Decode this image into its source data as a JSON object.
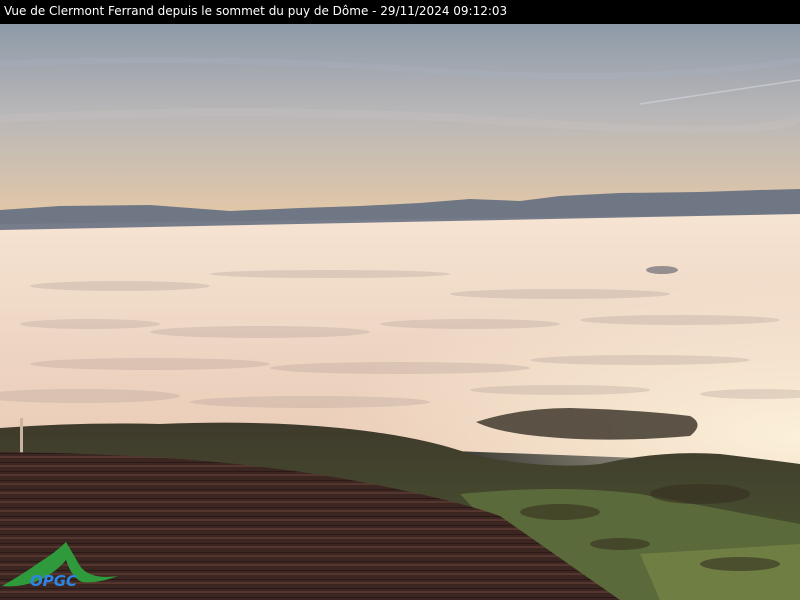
{
  "caption": {
    "text": "Vue de Clermont Ferrand depuis le sommet du puy de Dôme - 29/11/2024 09:12:03"
  },
  "logo": {
    "text": "OPGC",
    "color": "#2d86e6",
    "swoosh_color": "#2f9a3c"
  },
  "scene": {
    "sky_top": "#8b97a6",
    "sky_horizon": "#e8c8a0",
    "mountains": "#6f7684",
    "cloud_sea": "#f2dcc8",
    "roof": "#3a2420",
    "fields": "#5b6a3a"
  }
}
